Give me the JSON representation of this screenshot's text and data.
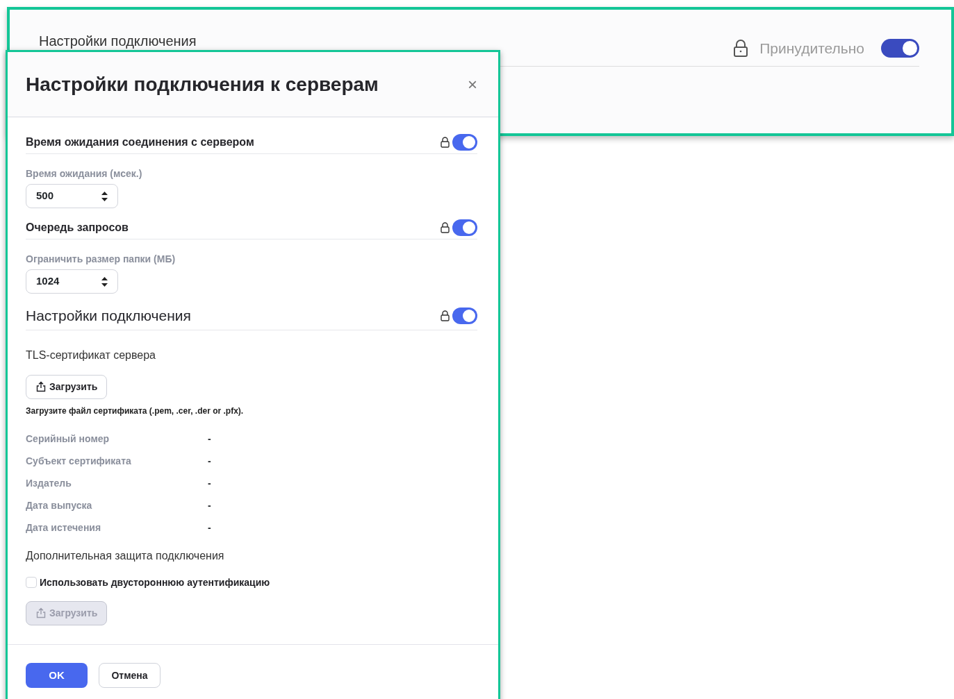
{
  "background_panel": {
    "title": "Настройки подключения",
    "forced": {
      "label": "Принудительно",
      "on": true
    }
  },
  "dialog": {
    "title": "Настройки подключения к серверам",
    "close": "×",
    "items": [
      {
        "kind": "toggle",
        "label": "Время ожидания соединения с сервером",
        "on": true
      },
      {
        "kind": "number",
        "label": "Время ожидания (мсек.)",
        "value": "500"
      },
      {
        "kind": "toggle",
        "label": "Очередь запросов",
        "on": true
      },
      {
        "kind": "number",
        "label": "Ограничить размер папки (МБ)",
        "value": "1024"
      },
      {
        "kind": "title_toggle",
        "label": "Настройки подключения",
        "on": true
      },
      {
        "kind": "subheading",
        "text": "TLS-сертификат сервера"
      },
      {
        "kind": "upload",
        "label": "Загрузить",
        "disabled": false
      },
      {
        "kind": "hint",
        "text": "Загрузите файл сертификата (.pem, .cer, .der or .pfx)."
      },
      {
        "kind": "property",
        "label": "Серийный номер",
        "value": "-"
      },
      {
        "kind": "property",
        "label": "Субъект сертификата",
        "value": "-"
      },
      {
        "kind": "property",
        "label": "Издатель",
        "value": "-"
      },
      {
        "kind": "property",
        "label": "Дата выпуска",
        "value": "-"
      },
      {
        "kind": "property",
        "label": "Дата истечения",
        "value": "-"
      },
      {
        "kind": "subheading",
        "text": "Дополнительная защита подключения"
      },
      {
        "kind": "checkbox",
        "label": "Использовать двустороннюю аутентификацию",
        "checked": false
      },
      {
        "kind": "upload",
        "label": "Загрузить",
        "disabled": true
      }
    ],
    "buttons": [
      {
        "label": "OK",
        "primary": true
      },
      {
        "label": "Отмена",
        "primary": false
      }
    ]
  }
}
